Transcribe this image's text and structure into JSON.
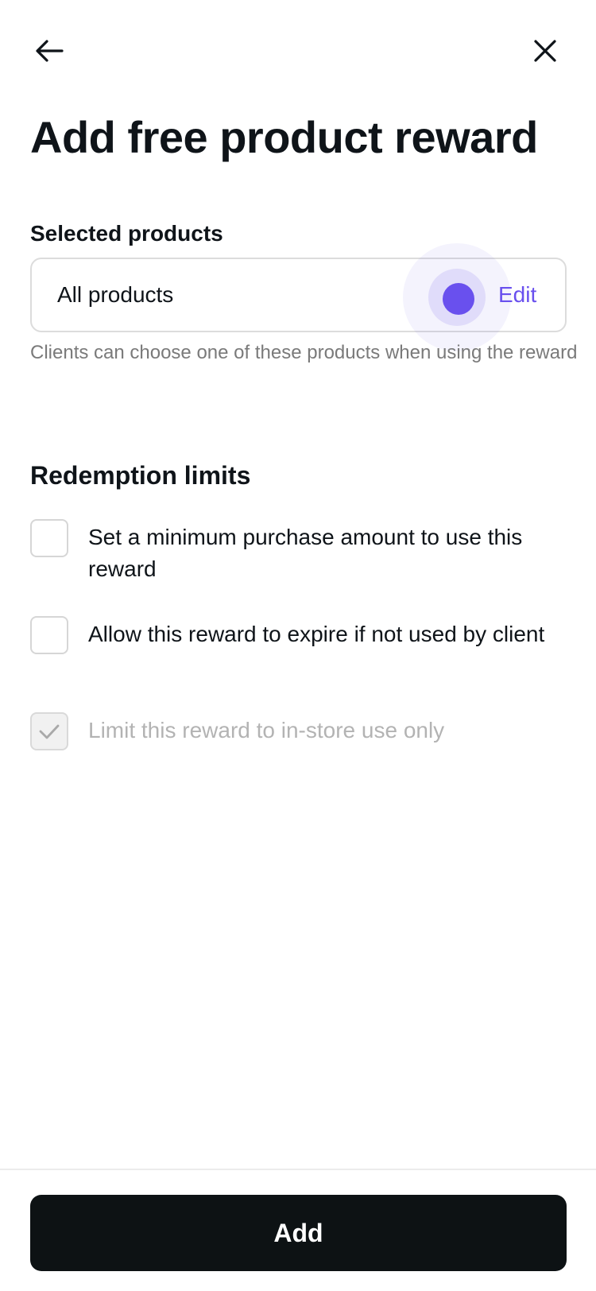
{
  "header": {
    "back_icon": "arrow-left-icon",
    "close_icon": "close-icon",
    "title": "Add free product reward"
  },
  "products": {
    "section_label": "Selected products",
    "value": "All products",
    "edit_label": "Edit",
    "helper_text": "Clients can choose one of these products when using the reward"
  },
  "limits": {
    "section_label": "Redemption limits",
    "options": [
      {
        "label": "Set a minimum purchase amount to use this reward",
        "checked": false,
        "disabled": false
      },
      {
        "label": "Allow this reward to expire if not used by client",
        "checked": false,
        "disabled": false
      },
      {
        "label": "Limit this reward to in-store use only",
        "checked": true,
        "disabled": true
      }
    ]
  },
  "footer": {
    "add_label": "Add"
  },
  "colors": {
    "accent": "#6950ee",
    "primary_button": "#0d1214",
    "text": "#0f1419",
    "muted_text": "#7a7a7a",
    "disabled_text": "#b3b3b3"
  }
}
